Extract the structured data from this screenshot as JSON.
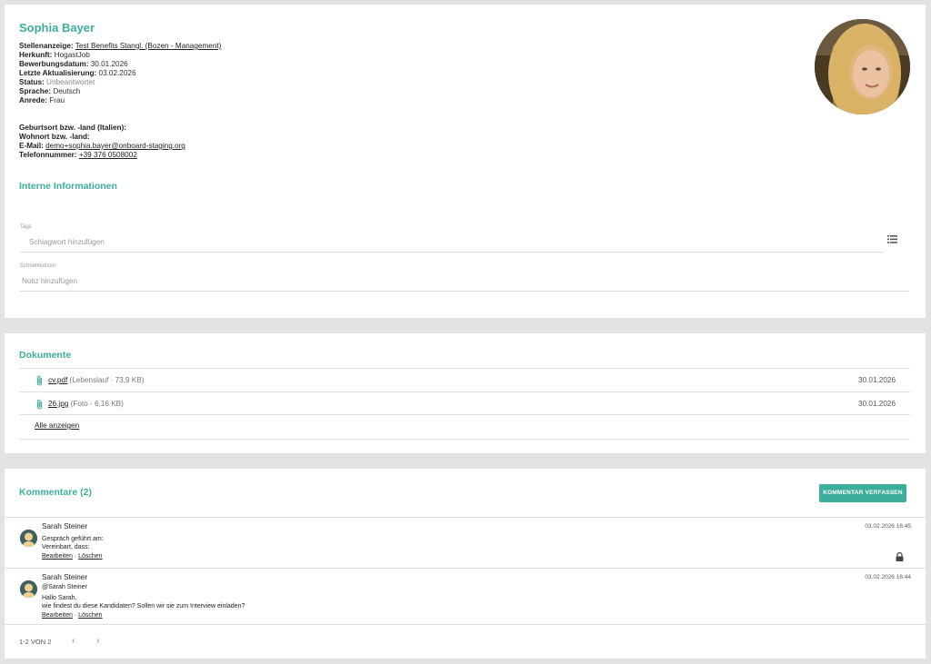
{
  "profile": {
    "name": "Sophia Bayer",
    "job_ad_label": "Stellenanzeige:",
    "job_ad_value": "Test Benefits Stangl. (Bozen - Management)",
    "origin_label": "Herkunft:",
    "origin_value": "HogastJob",
    "applied_label": "Bewerbungsdatum:",
    "applied_value": "30.01.2026",
    "updated_label": "Letzte Aktualisierung:",
    "updated_value": "03.02.2026",
    "status_label": "Status:",
    "status_value": "Unbeantwortet",
    "language_label": "Sprache:",
    "language_value": "Deutsch",
    "salutation_label": "Anrede:",
    "salutation_value": "Frau",
    "birthplace_label": "Geburtsort bzw. -land (Italien):",
    "residence_label": "Wohnort bzw. -land:",
    "email_label": "E-Mail:",
    "email_value": "demo+sophia.bayer@onboard-staging.org",
    "phone_label": "Telefonnummer:",
    "phone_value": "+39 376 0508002"
  },
  "internal": {
    "title": "Interne Informationen",
    "tags_label": "Tags",
    "tags_placeholder": "Schlagwort hinzufügen",
    "notes_label": "Schnellnotizen",
    "notes_placeholder": "Notiz hinzufügen"
  },
  "documents": {
    "title": "Dokumente",
    "items": [
      {
        "name": "cv.pdf",
        "meta": "(Lebenslauf · 73,9 KB)",
        "date": "30.01.2026"
      },
      {
        "name": "26.jpg",
        "meta": "(Foto · 6,16 KB)",
        "date": "30.01.2026"
      }
    ],
    "show_all": "Alle anzeigen"
  },
  "comments": {
    "title": "Kommentare (2)",
    "write_button": "KOMMENTAR VERFASSEN",
    "items": [
      {
        "author": "Sarah Steiner",
        "date": "03.02.2026 16:45",
        "line1": "Gespräch geführt am:",
        "line2": "Vereinbart, dass:",
        "edit": "Bearbeiten",
        "sep": " · ",
        "delete": "Löschen"
      },
      {
        "author": "Sarah Steiner",
        "date": "03.02.2026 16:44",
        "mention": "@Sarah Steiner",
        "line1": "Hallo Sarah,",
        "line2": "wie findest du diese Kandidaten? Sollen wir sie zum Interview einladen?",
        "edit": "Bearbeiten",
        "sep": " · ",
        "delete": "Löschen"
      }
    ],
    "pager": "1-2 VON 2",
    "prev": "‹",
    "next": "›"
  },
  "colors": {
    "accent": "#3dae9c",
    "background": "#e3e3e3"
  }
}
